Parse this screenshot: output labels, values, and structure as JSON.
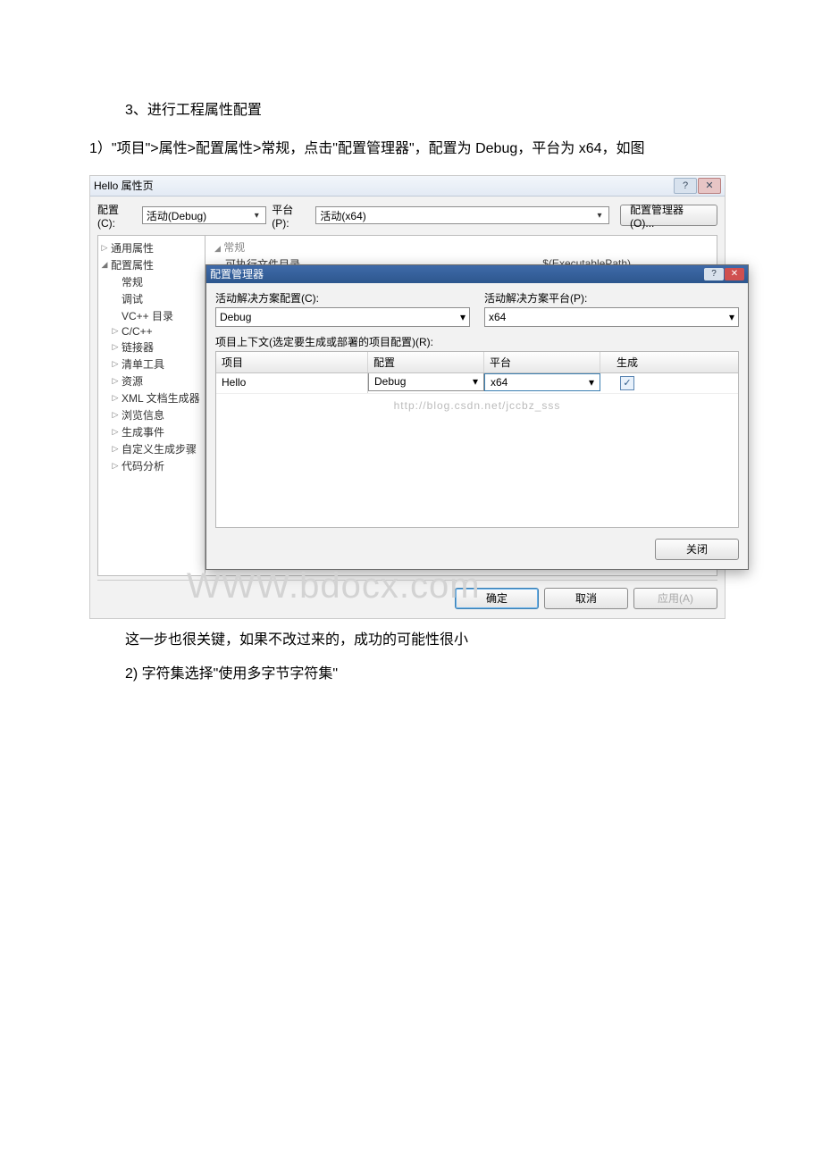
{
  "text": {
    "line1": "3、进行工程属性配置",
    "line2": "1）\"项目\">属性>配置属性>常规，点击\"配置管理器\"，配置为 Debug，平台为 x64，如图",
    "line3": "这一步也很关键，如果不改过来的，成功的可能性很小",
    "line4": "2) 字符集选择\"使用多字节字符集\""
  },
  "window": {
    "title": "Hello 属性页",
    "help_glyph": "?",
    "close_glyph": "✕",
    "cfg_label": "配置(C):",
    "cfg_value": "活动(Debug)",
    "plt_label": "平台(P):",
    "plt_value": "活动(x64)",
    "cfgmgr_btn": "配置管理器(O)...",
    "tree": {
      "n_common": "通用属性",
      "n_cfgprop": "配置属性",
      "n_general": "常规",
      "n_debug": "调试",
      "n_vcdir": "VC++ 目录",
      "n_cc": "C/C++",
      "n_linker": "链接器",
      "n_manifest": "清单工具",
      "n_res": "资源",
      "n_xml": "XML 文档生成器",
      "n_browse": "浏览信息",
      "n_buildev": "生成事件",
      "n_custom": "自定义生成步骤",
      "n_code": "代码分析"
    },
    "panel": {
      "group1": "常规",
      "row1_key": "可执行文件目录",
      "row1_val": "$(ExecutablePath)"
    },
    "footer": {
      "ok": "确定",
      "cancel": "取消",
      "apply": "应用(A)"
    }
  },
  "cm": {
    "title": "配置管理器",
    "lbl_active_cfg": "活动解决方案配置(C):",
    "val_active_cfg": "Debug",
    "lbl_active_plt": "活动解决方案平台(P):",
    "val_active_plt": "x64",
    "caption": "项目上下文(选定要生成或部署的项目配置)(R):",
    "col_proj": "项目",
    "col_cfg": "配置",
    "col_plt": "平台",
    "col_build": "生成",
    "row_proj": "Hello",
    "row_cfg": "Debug",
    "row_plt": "x64",
    "row_check": "✓",
    "close": "关闭"
  },
  "watermarks": {
    "url": "http://blog.csdn.net/jccbz_sss",
    "big": "WWW.bdocx.com"
  }
}
